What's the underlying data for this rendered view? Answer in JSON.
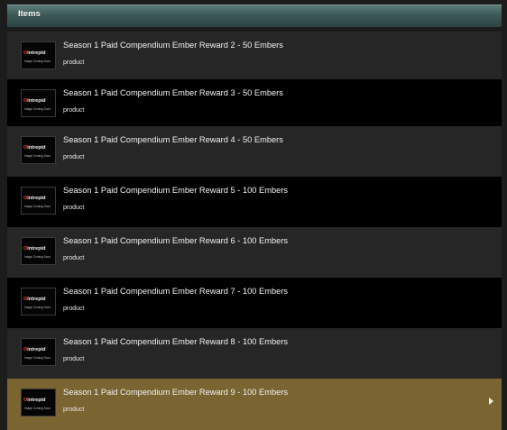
{
  "header": {
    "title": "Items"
  },
  "thumbnail": {
    "brand_mark": "ʘ",
    "brand_text": "intrepid",
    "placeholder": "Image Coming Soon"
  },
  "items": [
    {
      "title": "Season 1 Paid Compendium Ember Reward 2 - 50 Embers",
      "type": "product"
    },
    {
      "title": "Season 1 Paid Compendium Ember Reward 3 - 50 Embers",
      "type": "product"
    },
    {
      "title": "Season 1 Paid Compendium Ember Reward 4 - 50 Embers",
      "type": "product"
    },
    {
      "title": "Season 1 Paid Compendium Ember Reward 5 - 100 Embers",
      "type": "product"
    },
    {
      "title": "Season 1 Paid Compendium Ember Reward 6 - 100 Embers",
      "type": "product"
    },
    {
      "title": "Season 1 Paid Compendium Ember Reward 7 - 100 Embers",
      "type": "product"
    },
    {
      "title": "Season 1 Paid Compendium Ember Reward 8 - 100 Embers",
      "type": "product"
    },
    {
      "title": "Season 1 Paid Compendium Ember Reward 9 - 100 Embers",
      "type": "product",
      "selected": true
    }
  ],
  "colors": {
    "row_odd": "#262626",
    "row_even": "#000000",
    "row_selected": "#7a6432",
    "header": "#3c5857"
  }
}
